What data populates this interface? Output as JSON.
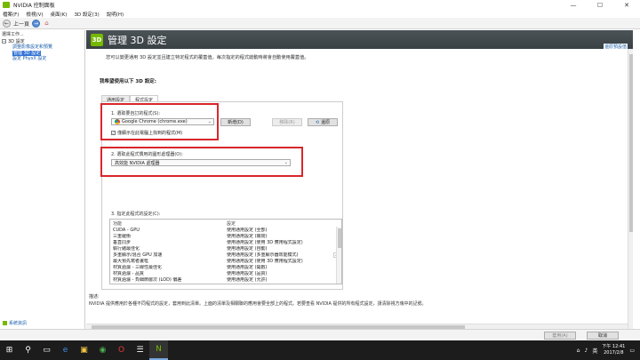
{
  "window": {
    "title": "NVIDIA 控制面板",
    "controls": [
      "—",
      "☐",
      "✕"
    ]
  },
  "menubar": [
    "檔案(F)",
    "檢視(V)",
    "桌面(K)",
    "3D 設定(3)",
    "說明(H)"
  ],
  "toolbar": {
    "back_label": "上一頁",
    "forward_label": "→",
    "home_label": "⌂"
  },
  "left": {
    "header": "選擇工作...",
    "root": "3D 設定",
    "items": [
      "調整影像設定和預覽",
      "管理 3D 設定",
      "設定 PhysX 設定"
    ],
    "selected_index": 1,
    "footer": "系統資訊"
  },
  "main": {
    "title": "管理 3D 設定",
    "restore_link": "還原預設值",
    "description": "您可以變更通用 3D 設定並且建立特定程式的覆蓋值。每次指定的程式啟動時將會自動使用覆蓋值。",
    "section_label": "我希望使用以下 3D 設定:",
    "tabs": [
      "通用設定",
      "程式設定"
    ],
    "active_tab": 1,
    "step1": "1. 選取要自訂的程式(S):",
    "program_selected": "Google Chrome (chrome.exe)",
    "btn_add": "新增(D)",
    "btn_remove": "移除(R)",
    "btn_restore": "還原",
    "checkbox_label": "僅顯示在此電腦上找到的程式(M)",
    "checkbox_checked": true,
    "step2": "2. 選取此程式慣用的圖形處理器(O):",
    "gpu_selected": "高效能 NVIDIA 處理器",
    "step3": "3. 指定此程式的設定(C):",
    "features_header": [
      "功能",
      "設定"
    ],
    "features": [
      [
        "CUDA - GPU",
        "使用通用設定 (全部)"
      ],
      [
        "三重緩衝",
        "使用通用設定 (關閉)"
      ],
      [
        "垂直同步",
        "使用通用設定 (使用 3D 應用程式設定)"
      ],
      [
        "執行緒最佳化",
        "使用通用設定 (自動)"
      ],
      [
        "多重顯示/混合 GPU 加速",
        "使用通用設定 (多重顯示器效能模式)"
      ],
      [
        "最大預先寫者畫框",
        "使用通用設定 (使用 3D 應用程式設定)"
      ],
      [
        "材質過濾 - 三線性最佳化",
        "使用通用設定 (開啟)"
      ],
      [
        "材質過濾 - 品質",
        "使用通用設定 (品質)"
      ],
      [
        "材質過濾 - 負細節層次 (LOD) 偏差",
        "使用通用設定 (允許)"
      ]
    ],
    "desc_title": "描述:",
    "desc_text": "NVIDIA 提供應用於各種不同程式的設定，套用到此清單。上面的清單及相關聯的應用會要全部上的程式。若要查看 NVIDIA 提供的所有程式設定，請清除視方塊中的記號。"
  },
  "bottom": {
    "apply": "套用(A)",
    "cancel": "取消"
  },
  "taskbar": {
    "icons": [
      "⊞",
      "⚲",
      "▭",
      "e",
      "▣",
      "◉",
      "O",
      "☰",
      "N"
    ],
    "tray_lang": "英",
    "time": "下午 12:41",
    "date": "2017/2/8"
  }
}
